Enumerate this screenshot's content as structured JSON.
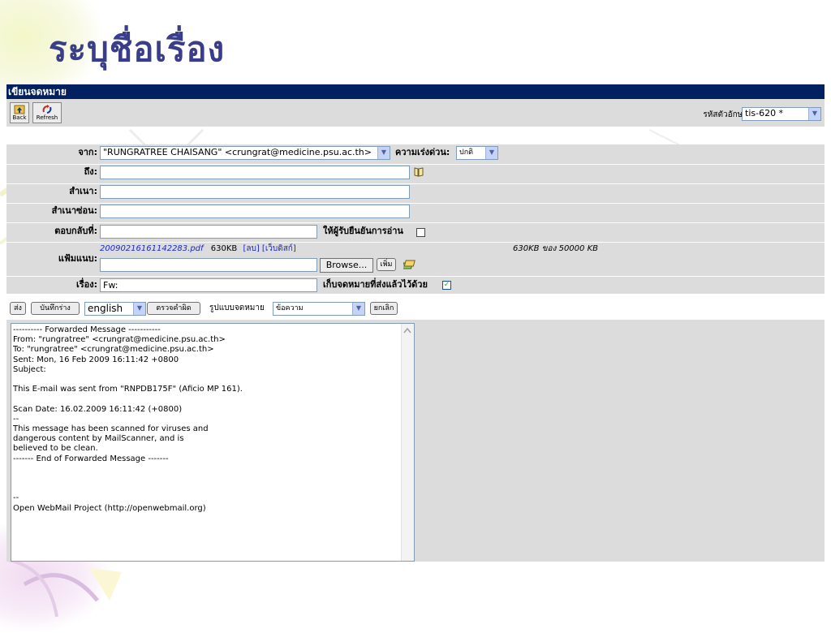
{
  "slide_title": "ระบุชื่อเรื่อง",
  "window": {
    "header_title": "เขียนจดหมาย",
    "back_label": "Back",
    "refresh_label": "Refresh",
    "charset_label": "รหัสตัวอักษร:",
    "charset_value": "tis-620 *"
  },
  "form": {
    "from_label": "จาก:",
    "from_value": "\"RUNGRATREE CHAISANG\" <crungrat@medicine.psu.ac.th>",
    "priority_label": "ความเร่งด่วน:",
    "priority_value": "ปกติ",
    "to_label": "ถึง:",
    "to_value": "",
    "cc_label": "สำเนา:",
    "cc_value": "",
    "bcc_label": "สำเนาซ่อน:",
    "bcc_value": "",
    "replyto_label": "ตอบกลับที่:",
    "replyto_value": "",
    "read_receipt_label": "ให้ผู้รับยืนยันการอ่าน",
    "read_receipt_checked": false,
    "attachment_label": "แฟ้มแนบ:",
    "attachment_file": "20090216161142283.pdf",
    "attachment_size": "630KB",
    "attachment_delete": "[ลบ]",
    "attachment_webdisk": "[เว็บดิสก์]",
    "attachment_quota": "630KB ของ 50000 KB",
    "browse_label": "Browse...",
    "add_label": "เพิ่ม",
    "subject_label": "เรื่อง:",
    "subject_value": "Fw:",
    "save_sent_label": "เก็บจดหมายที่ส่งแล้วไว้ด้วย",
    "save_sent_checked": true
  },
  "actions": {
    "send_label": "ส่ง",
    "draft_label": "บันทึกร่าง",
    "language_value": "english",
    "spellcheck_label": "ตรวจคำผิด",
    "format_label": "รูปแบบจดหมาย",
    "format_value": "ข้อความ",
    "cancel_label": "ยกเลิก"
  },
  "message": {
    "lines": [
      "---------- Forwarded Message -----------",
      "From: \"rungratree\" <crungrat@medicine.psu.ac.th>",
      "To: \"rungratree\" <crungrat@medicine.psu.ac.th>",
      "Sent: Mon, 16 Feb 2009 16:11:42 +0800",
      "Subject:",
      "",
      "This E-mail was sent from \"RNPDB175F\" (Aficio MP 161).",
      "",
      "Scan Date: 16.02.2009 16:11:42 (+0800)",
      "--",
      "This message has been scanned for viruses and",
      "dangerous content by MailScanner, and is",
      "believed to be clean.",
      "------- End of Forwarded Message -------",
      "",
      "",
      "",
      "--",
      "Open WebMail Project (http://openwebmail.org)"
    ]
  },
  "colors": {
    "header_bg": "#00205f",
    "panel_bg": "#dcdcdc",
    "title_color": "#3a3d8a",
    "link_color": "#1a28c6",
    "check_color": "#21a121"
  },
  "icons": {
    "back": "folder-up-icon",
    "refresh": "refresh-arrows-icon",
    "addressbook": "address-book-icon",
    "attach_add": "stack-add-icon"
  }
}
